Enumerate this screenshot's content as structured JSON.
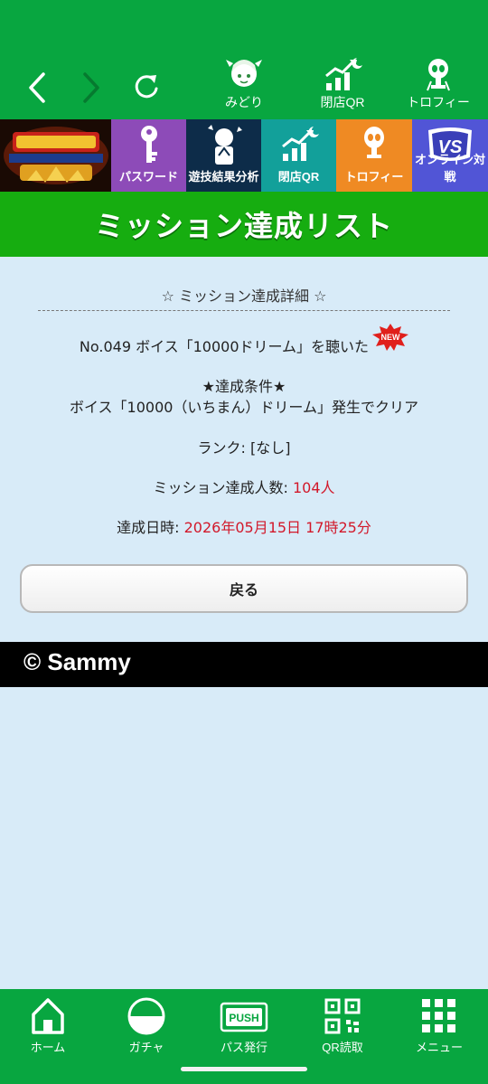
{
  "topbar": {
    "items": [
      {
        "label": "みどり",
        "icon": "midori-character-icon"
      },
      {
        "label": "閉店QR",
        "icon": "qr-chart-icon"
      },
      {
        "label": "トロフィー",
        "icon": "trophy-icon"
      }
    ]
  },
  "tabs": [
    {
      "label": "パスワード",
      "icon": "key-icon"
    },
    {
      "label": "遊技結果分析",
      "icon": "analysis-icon"
    },
    {
      "label": "閉店QR",
      "icon": "qr-chart-icon"
    },
    {
      "label": "トロフィー",
      "icon": "trophy-icon"
    },
    {
      "label": "オンライン対戦",
      "icon": "vs-icon"
    }
  ],
  "page_title": "ミッション達成リスト",
  "detail": {
    "section_title": "☆ ミッション達成詳細 ☆",
    "mission_name": "No.049 ボイス「10000ドリーム」を聴いた",
    "new_badge": "NEW",
    "condition_heading": "★達成条件★",
    "condition_text": "ボイス「10000（いちまん）ドリーム」発生でクリア",
    "rank_label": "ランク: ",
    "rank_value": "[なし]",
    "count_label": "ミッション達成人数: ",
    "count_value": "104人",
    "date_label": "達成日時: ",
    "date_value": "2026年05月15日 17時25分"
  },
  "back_button": "戻る",
  "copyright": "© Sammy",
  "bottom_nav": [
    {
      "label": "ホーム",
      "icon": "home-icon"
    },
    {
      "label": "ガチャ",
      "icon": "gacha-icon"
    },
    {
      "label": "パス発行",
      "icon": "push-icon"
    },
    {
      "label": "QR読取",
      "icon": "qr-code-icon"
    },
    {
      "label": "メニュー",
      "icon": "menu-grid-icon"
    }
  ],
  "colors": {
    "header_green": "#08a640",
    "title_green": "#16ad10",
    "content_bg": "#d8ebf8",
    "accent_red": "#d2182a"
  }
}
